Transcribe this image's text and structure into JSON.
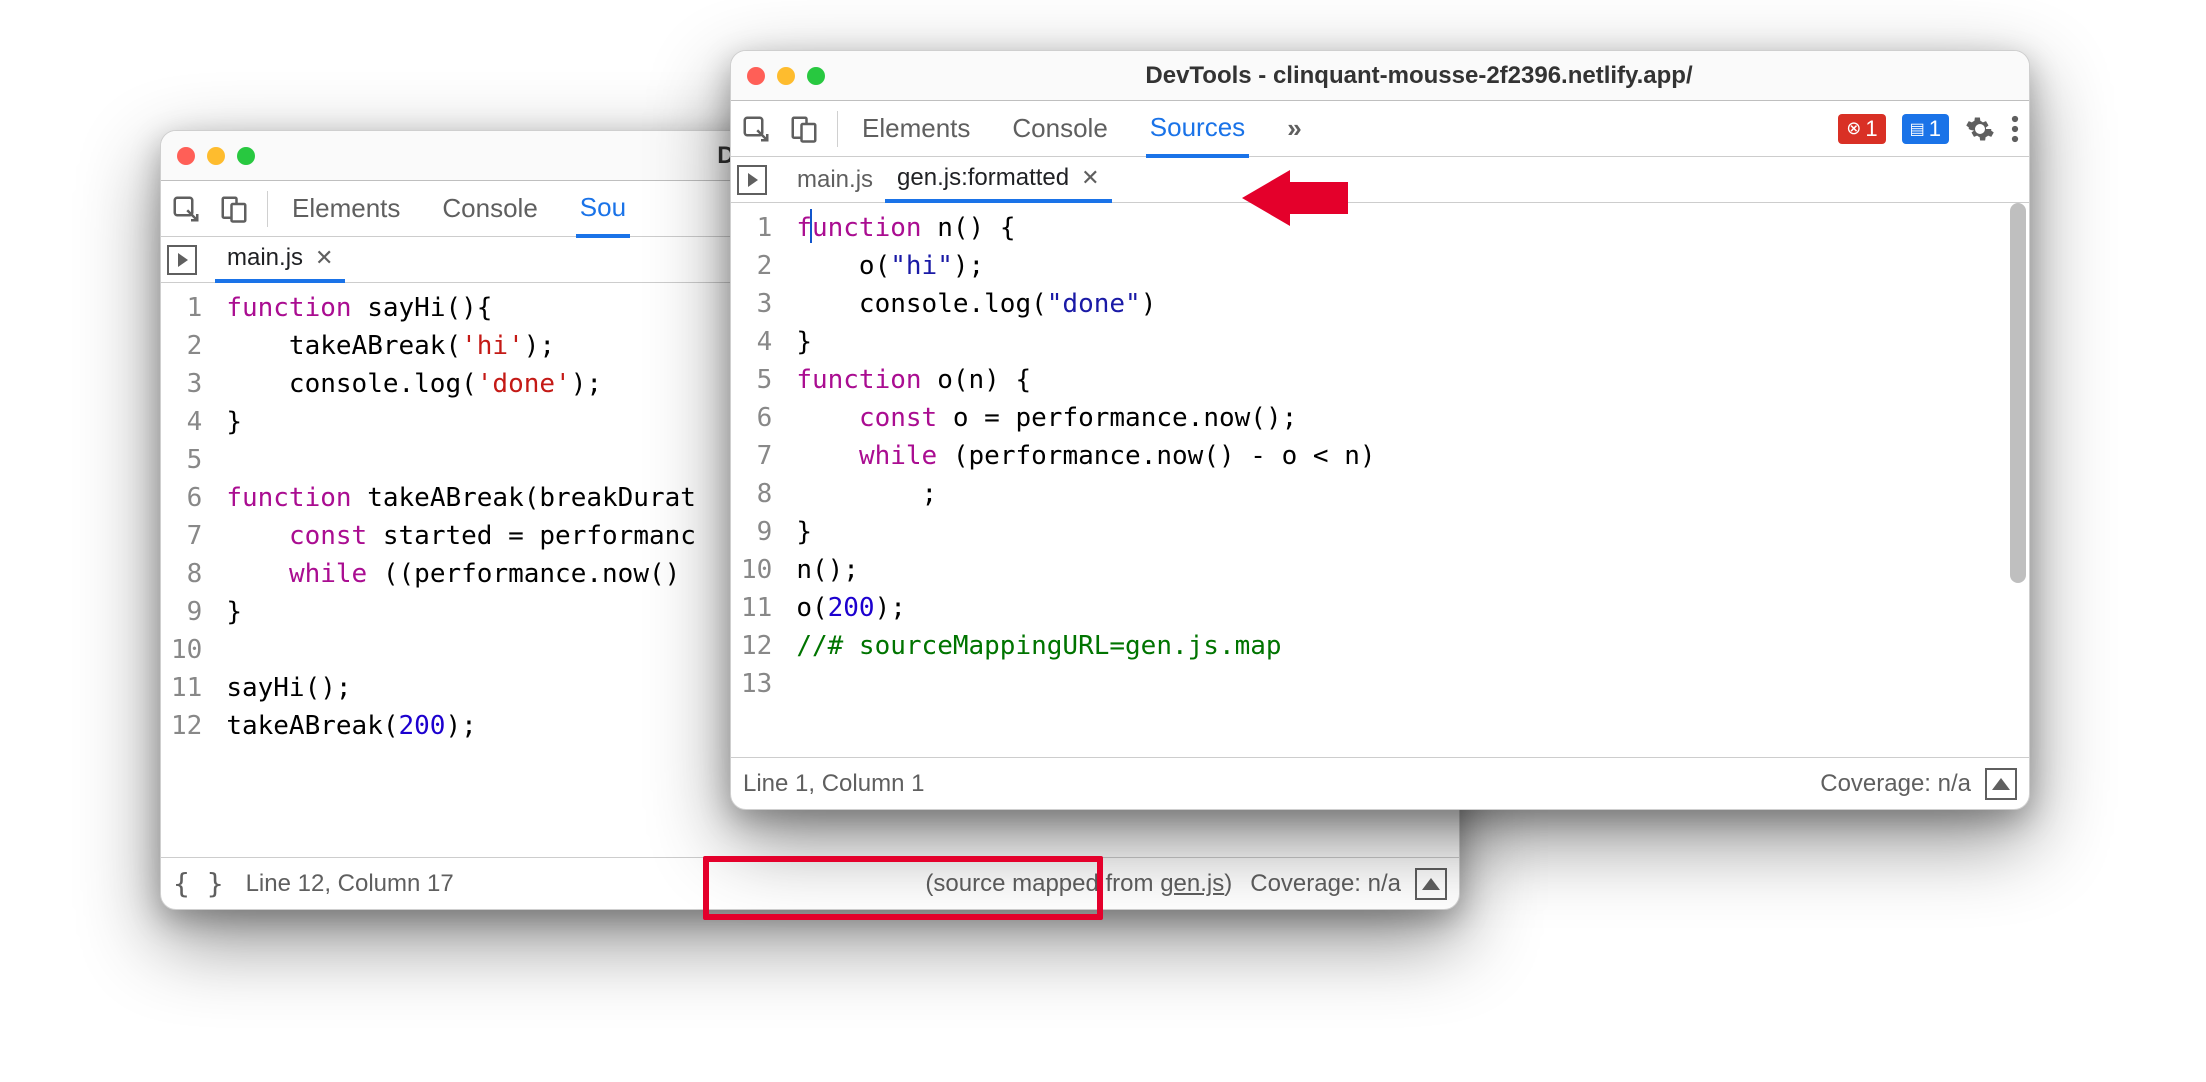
{
  "back": {
    "title": "DevTools - clinquant-m",
    "panels": {
      "elements": "Elements",
      "console": "Console",
      "sources": "Sou"
    },
    "file_tab": "main.js",
    "gutter": " 1\n 2\n 3\n 4\n 5\n 6\n 7\n 8\n 9\n10\n11\n12",
    "code_html": "<span class=\"kw\">function</span> sayHi(){\n    takeABreak(<span class=\"str2\">'hi'</span>);\n    console.log(<span class=\"str2\">'done'</span>);\n}\n\n<span class=\"kw\">function</span> takeABreak(breakDurat\n    <span class=\"kw\">const</span> started = performanc\n    <span class=\"kw\">while</span> ((performance.now() \n}\n\nsayHi();\ntakeABreak(<span class=\"num\">200</span>);",
    "status": {
      "braces": "{ }",
      "pos": "Line 12, Column 17",
      "mapped_prefix": "(source mapped from ",
      "mapped_link": "gen.js",
      "mapped_suffix": ")",
      "coverage": "Coverage: n/a"
    }
  },
  "front": {
    "title": "DevTools - clinquant-mousse-2f2396.netlify.app/",
    "panels": {
      "elements": "Elements",
      "console": "Console",
      "sources": "Sources",
      "more": "»"
    },
    "badges": {
      "error": "1",
      "info": "1"
    },
    "file_tabs": {
      "main": "main.js",
      "gen": "gen.js:formatted"
    },
    "gutter": " 1\n 2\n 3\n 4\n 5\n 6\n 7\n 8\n 9\n10\n11\n12\n13",
    "code_html": "<span class=\"kw\">function</span> n() {\n    o(<span class=\"str\">\"hi\"</span>);\n    console.log(<span class=\"str\">\"done\"</span>)\n}\n<span class=\"kw\">function</span> o(n) {\n    <span class=\"kw\">const</span> o = performance.now();\n    <span class=\"kw\">while</span> (performance.now() - o &lt; n)\n        ;\n}\nn();\no(<span class=\"num\">200</span>);\n<span class=\"cmt\">//# sourceMappingURL=gen.js.map</span>\n",
    "status": {
      "pos": "Line 1, Column 1",
      "coverage": "Coverage: n/a"
    }
  }
}
